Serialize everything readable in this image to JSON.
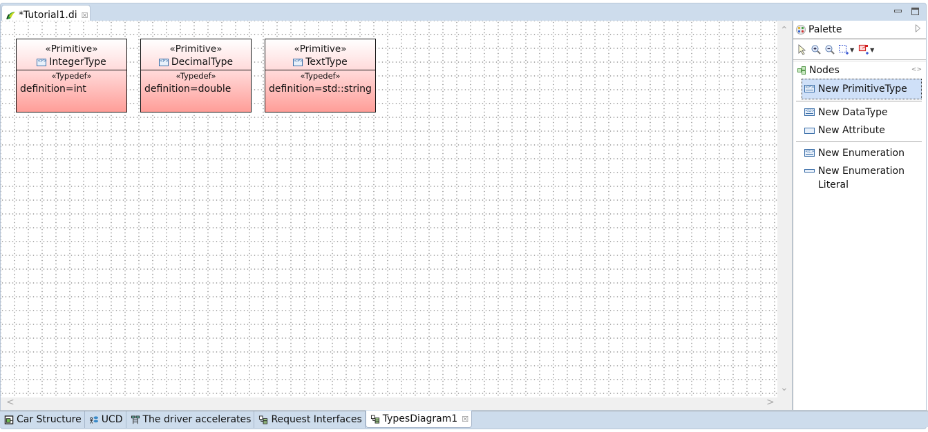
{
  "editor": {
    "tab_title": "*Tutorial1.di",
    "tab_icon": "papyrus-icon",
    "close_glyph": "☒"
  },
  "nodes": [
    {
      "stereotype": "«Primitive»",
      "name": "IntegerType",
      "icon": "primitive-type-icon",
      "section_stereotype": "«Typedef»",
      "definition": "definition=int"
    },
    {
      "stereotype": "«Primitive»",
      "name": "DecimalType",
      "icon": "primitive-type-icon",
      "section_stereotype": "«Typedef»",
      "definition": "definition=double"
    },
    {
      "stereotype": "«Primitive»",
      "name": "TextType",
      "icon": "primitive-type-icon",
      "section_stereotype": "«Typedef»",
      "definition": "definition=std::string"
    }
  ],
  "palette": {
    "title": "Palette",
    "drawer": "Nodes",
    "tools": [
      {
        "label": "New PrimitiveType",
        "icon_text": "<P>",
        "selected": true
      },
      {
        "label": "New DataType",
        "icon_text": "<D>"
      },
      {
        "label": "New Attribute",
        "icon_text": ""
      },
      {
        "label": "New Enumeration",
        "icon_text": "<E>"
      },
      {
        "label": "New Enumeration Literal",
        "icon_text": ""
      }
    ]
  },
  "bottom_tabs": [
    {
      "label": "Car Structure",
      "icon": "composite-diagram-icon"
    },
    {
      "label": "UCD",
      "icon": "usecase-diagram-icon"
    },
    {
      "label": "The driver accelerates",
      "icon": "sequence-diagram-icon"
    },
    {
      "label": "Request Interfaces",
      "icon": "class-diagram-icon"
    },
    {
      "label": "TypesDiagram1",
      "icon": "class-diagram-icon",
      "active": true
    }
  ],
  "scroll": {
    "up": "⌃",
    "down": "⌄",
    "left": "<",
    "right": ">"
  }
}
